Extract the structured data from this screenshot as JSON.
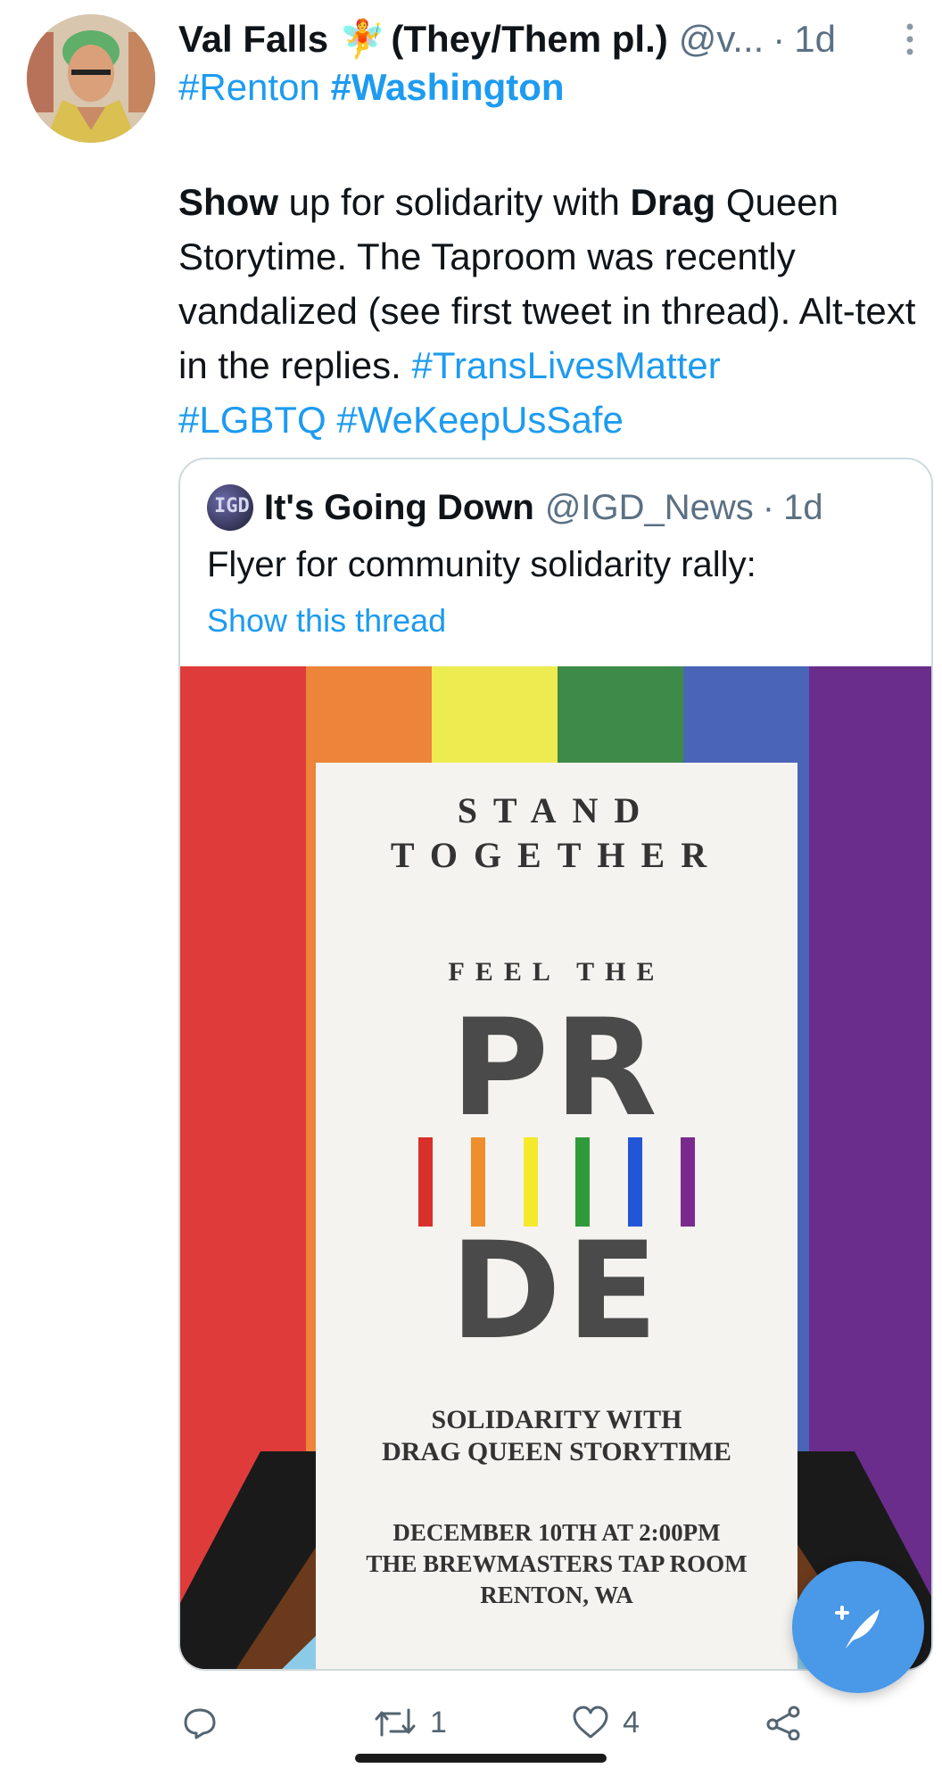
{
  "tweet": {
    "author_name": "Val Falls",
    "author_emoji": "🧚",
    "author_pronouns": "(They/Them pl.)",
    "author_handle": "@v...",
    "separator": "·",
    "time": "1d",
    "hashtag_1": "#Renton",
    "hashtag_2": "#Washington",
    "text": {
      "w1": "Show",
      "t1": " up for solidarity with ",
      "w2": "Drag",
      "t2": " Queen Storytime. The Taproom was recently vandalized (see first tweet in thread). Alt-text in the replies. ",
      "tag1": "#TransLivesMatter",
      "tag2": "#LGBTQ",
      "tag3": "#WeKeepUsSafe"
    }
  },
  "quote": {
    "avatar_text": "IGD",
    "name": "It's Going Down",
    "handle": "@IGD_News",
    "separator": "·",
    "time": "1d",
    "text": "Flyer for community solidarity rally:",
    "show_thread": "Show this thread",
    "flyer": {
      "line1": "STAND",
      "line2": "TOGETHER",
      "line3": "FEEL THE",
      "pr": "PR",
      "de": "DE",
      "solidarity1": "SOLIDARITY WITH",
      "solidarity2": "DRAG QUEEN STORYTIME",
      "details1": "DECEMBER 10TH AT 2:00PM",
      "details2": "THE BREWMASTERS TAP ROOM",
      "details3": "RENTON, WA",
      "stripe_colors": [
        "#e03b3b",
        "#ec853a",
        "#ecec50",
        "#3e8a48",
        "#4a64b8",
        "#6a2d8c"
      ],
      "bar_colors": [
        "#d9302c",
        "#ee8e2c",
        "#f5e92c",
        "#2f9a3a",
        "#2256d8",
        "#7a2a8e"
      ]
    }
  },
  "actions": {
    "reply_count": "",
    "retweet_count": "1",
    "like_count": "4"
  },
  "colors": {
    "accent": "#1d9bf0",
    "fab": "#4a98e8",
    "muted": "#5b7083"
  }
}
